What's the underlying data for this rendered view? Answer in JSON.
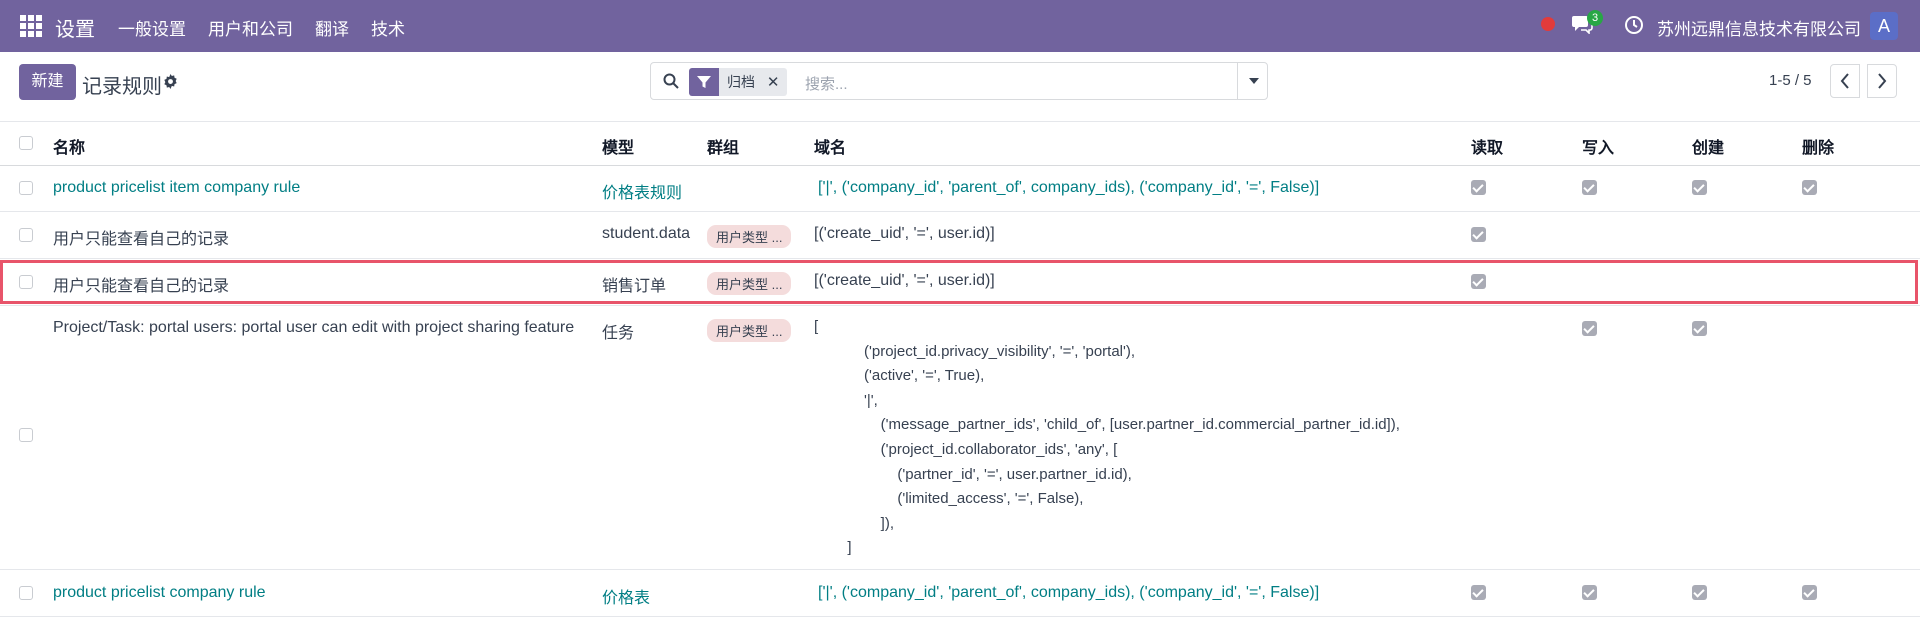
{
  "nav": {
    "brand": "设置",
    "menu": [
      "一般设置",
      "用户和公司",
      "翻译",
      "技术"
    ],
    "chat_count": "3",
    "company": "苏州远鼎信息技术有限公司",
    "avatar_letter": "A"
  },
  "control": {
    "new_label": "新建",
    "title": "记录规则",
    "facet_label": "归档",
    "search_placeholder": "搜索...",
    "pager": "1-5 / 5"
  },
  "table": {
    "headers": {
      "name": "名称",
      "model": "模型",
      "groups": "群组",
      "domain": "域名",
      "read": "读取",
      "write": "写入",
      "create": "创建",
      "delete": "删除"
    },
    "rows": [
      {
        "name": "product pricelist item company rule",
        "model": "价格表规则",
        "group": "",
        "domain": "['|', ('company_id', 'parent_of', company_ids), ('company_id', '=', False)]",
        "perms": [
          true,
          true,
          true,
          true
        ]
      },
      {
        "name": "用户只能查看自己的记录",
        "model": "student.data",
        "group": "用户类型 ...",
        "domain": "[('create_uid', '=', user.id)]",
        "perms": [
          true,
          false,
          false,
          false
        ]
      },
      {
        "name": "用户只能查看自己的记录",
        "model": "销售订单",
        "group": "用户类型 ...",
        "domain": "[('create_uid', '=', user.id)]",
        "perms": [
          true,
          false,
          false,
          false
        ]
      },
      {
        "name": "Project/Task: portal users: portal user can edit with project sharing feature",
        "model": "任务",
        "group": "用户类型 ...",
        "domain": "[\n            ('project_id.privacy_visibility', '=', 'portal'),\n            ('active', '=', True),\n            '|',\n                ('message_partner_ids', 'child_of', [user.partner_id.commercial_partner_id.id]),\n                ('project_id.collaborator_ids', 'any', [\n                    ('partner_id', '=', user.partner_id.id),\n                    ('limited_access', '=', False),\n                ]),\n        ]",
        "perms": [
          false,
          true,
          true,
          false
        ]
      },
      {
        "name": "product pricelist company rule",
        "model": "价格表",
        "group": "",
        "domain": "['|', ('company_id', 'parent_of', company_ids), ('company_id', '=', False)]",
        "perms": [
          true,
          true,
          true,
          true
        ]
      }
    ]
  }
}
